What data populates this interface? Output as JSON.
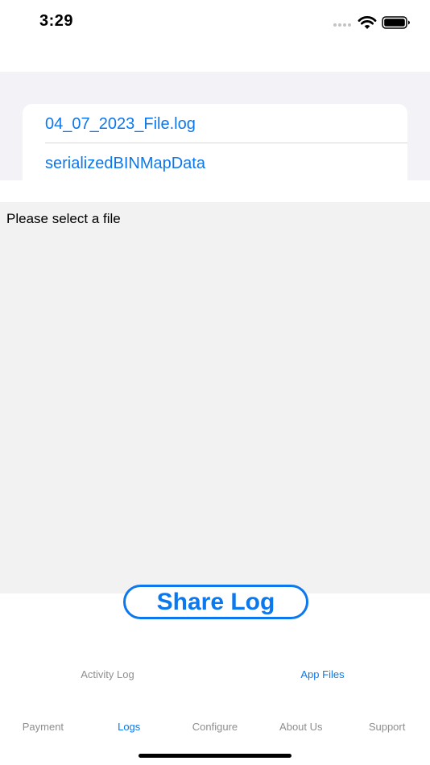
{
  "status_bar": {
    "time": "3:29",
    "icons": [
      "cellular-signal-icon",
      "wifi-icon",
      "battery-icon"
    ]
  },
  "file_list": {
    "items": [
      {
        "label": "04_07_2023_File.log"
      },
      {
        "label": "serializedBINMapData"
      }
    ]
  },
  "content": {
    "text": "Please select a file"
  },
  "share_button": {
    "label": "Share Log"
  },
  "segmented_control": {
    "items": [
      {
        "label": "Activity Log",
        "selected": false
      },
      {
        "label": "App Files",
        "selected": true
      }
    ]
  },
  "tab_bar": {
    "items": [
      {
        "label": "Payment",
        "active": false
      },
      {
        "label": "Logs",
        "active": true
      },
      {
        "label": "Configure",
        "active": false
      },
      {
        "label": "About Us",
        "active": false
      },
      {
        "label": "Support",
        "active": false
      }
    ]
  },
  "colors": {
    "accent": "#0b78ee",
    "inactive": "#8e8e8e",
    "grouped_background": "#f2f2f7",
    "content_background": "#f2f2f2"
  }
}
